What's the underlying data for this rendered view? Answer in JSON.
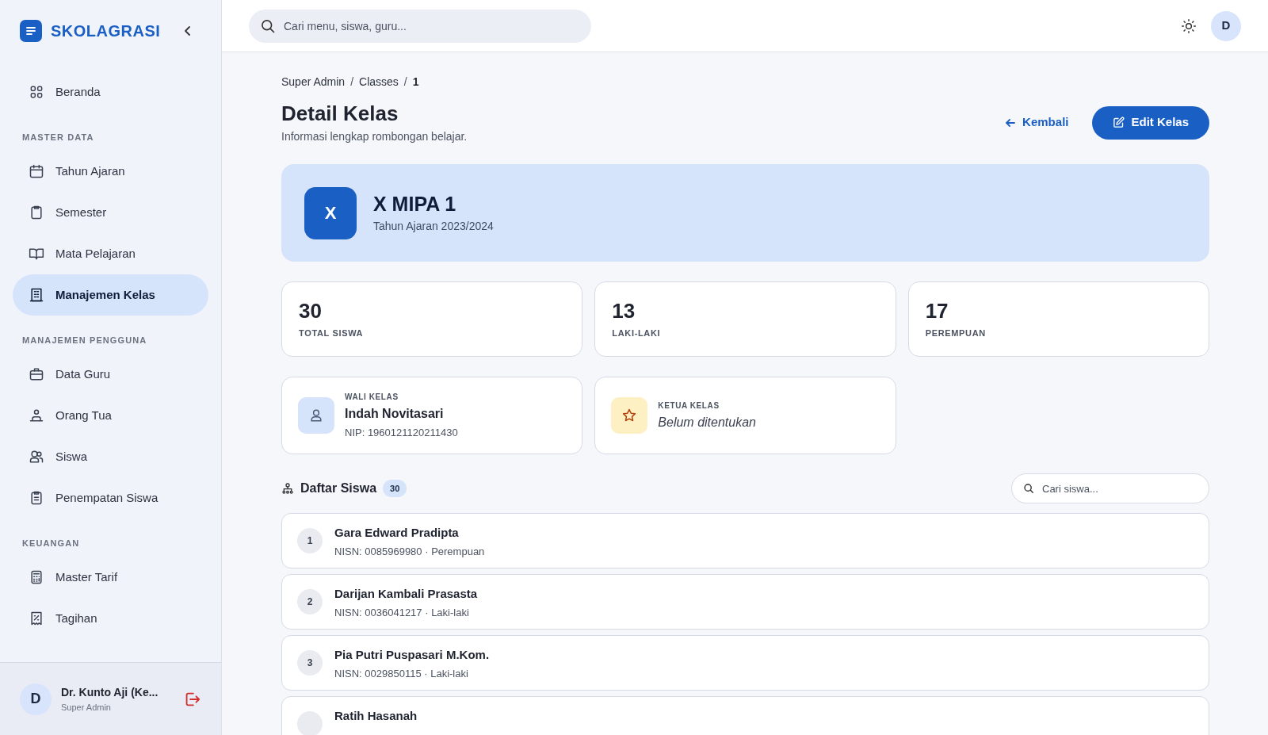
{
  "app": {
    "logo_text": "SKOLAGRASI"
  },
  "sidebar": {
    "sections": [
      {
        "items": [
          {
            "label": "Beranda",
            "selected": false
          }
        ]
      },
      {
        "heading": "MASTER DATA",
        "items": [
          {
            "label": "Tahun Ajaran",
            "selected": false
          },
          {
            "label": "Semester",
            "selected": false
          },
          {
            "label": "Mata Pelajaran",
            "selected": false
          },
          {
            "label": "Manajemen Kelas",
            "selected": true
          }
        ]
      },
      {
        "heading": "MANAJEMEN PENGGUNA",
        "items": [
          {
            "label": "Data Guru",
            "selected": false
          },
          {
            "label": "Orang Tua",
            "selected": false
          },
          {
            "label": "Siswa",
            "selected": false
          },
          {
            "label": "Penempatan Siswa",
            "selected": false
          }
        ]
      },
      {
        "heading": "KEUANGAN",
        "items": [
          {
            "label": "Master Tarif",
            "selected": false
          },
          {
            "label": "Tagihan",
            "selected": false
          }
        ]
      }
    ],
    "user": {
      "initial": "D",
      "name": "Dr. Kunto Aji (Ke...",
      "role": "Super Admin"
    }
  },
  "header": {
    "search": {
      "placeholder": "Cari menu, siswa, guru..."
    },
    "avatar": "D"
  },
  "breadcrumb": [
    {
      "kind": "link",
      "label": "Super Admin"
    },
    {
      "kind": "separator",
      "label": "/"
    },
    {
      "kind": "link",
      "label": "Classes"
    },
    {
      "kind": "separator",
      "label": "/"
    },
    {
      "kind": "current",
      "label": "1"
    }
  ],
  "page": {
    "title": "Detail Kelas",
    "subtitle": "Informasi lengkap rombongan belajar.",
    "back": "Kembali",
    "edit": "Edit Kelas"
  },
  "class": {
    "badge": "X",
    "name": "X MIPA 1",
    "year": "Tahun Ajaran 2023/2024"
  },
  "stats": [
    {
      "value": "30",
      "label": "TOTAL SISWA"
    },
    {
      "value": "13",
      "label": "LAKI-LAKI"
    },
    {
      "value": "17",
      "label": "PEREMPUAN"
    }
  ],
  "roles": [
    {
      "kind": "person",
      "label": "WALI KELAS",
      "name": "Indah Novitasari",
      "detail": "NIP: 1960121120211430",
      "assigned": true
    },
    {
      "kind": "star",
      "label": "KETUA KELAS",
      "name": "Belum ditentukan",
      "assigned": false
    }
  ],
  "students": {
    "title": "Daftar Siswa",
    "count": "30",
    "search": {
      "placeholder": "Cari siswa..."
    },
    "rows": [
      {
        "number": "1",
        "name": "Gara Edward Pradipta",
        "detail": "NISN: 0085969980 · Perempuan"
      },
      {
        "number": "2",
        "name": "Darijan Kambali Prasasta",
        "detail": "NISN: 0036041217 · Laki-laki"
      },
      {
        "number": "3",
        "name": "Pia Putri Puspasari M.Kom.",
        "detail": "NISN: 0029850115 · Laki-laki"
      },
      {
        "name": "Ratih Hasanah"
      }
    ]
  }
}
